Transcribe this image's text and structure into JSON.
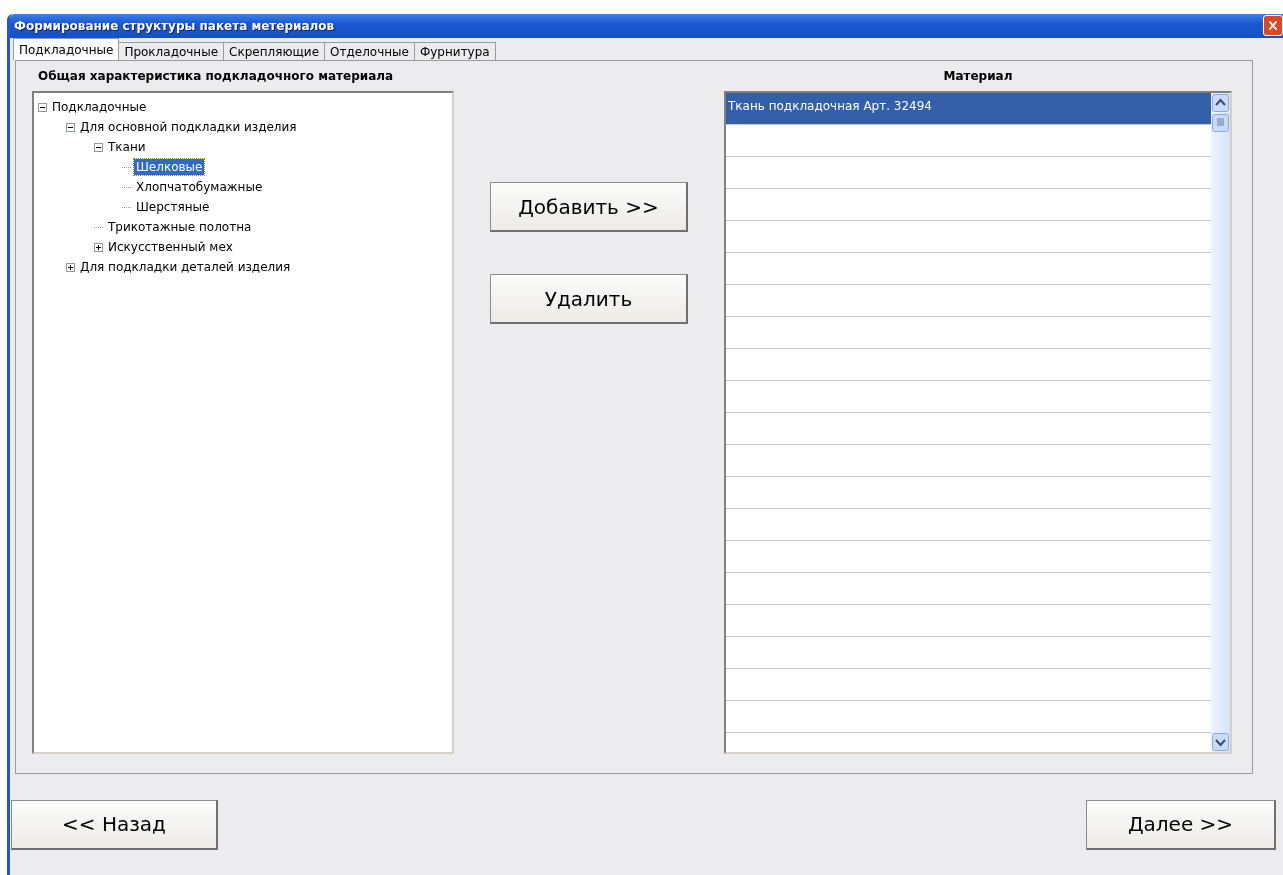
{
  "window": {
    "title": "Формирование структуры пакета метериалов"
  },
  "tabs": [
    {
      "label": "Подкладочные",
      "selected": true
    },
    {
      "label": "Прокладочные",
      "selected": false
    },
    {
      "label": "Скрепляющие",
      "selected": false
    },
    {
      "label": "Отделочные",
      "selected": false
    },
    {
      "label": "Фурнитура",
      "selected": false
    }
  ],
  "tree": {
    "title": "Общая характеристика подкладочного материала",
    "items": [
      {
        "label": "Подкладочные",
        "expanded": true,
        "selected": false,
        "children": [
          {
            "label": "Для основной подкладки изделия",
            "expanded": true,
            "selected": false,
            "children": [
              {
                "label": "Ткани",
                "expanded": true,
                "selected": false,
                "children": [
                  {
                    "label": "Шелковые",
                    "selected": true
                  },
                  {
                    "label": "Хлопчатобумажные",
                    "selected": false
                  },
                  {
                    "label": "Шерстяные",
                    "selected": false
                  }
                ]
              },
              {
                "label": "Трикотажные полотна",
                "selected": false
              },
              {
                "label": "Искусственный мех",
                "expanded": false,
                "selected": false
              }
            ]
          },
          {
            "label": "Для подкладки деталей изделия",
            "expanded": false,
            "selected": false
          }
        ]
      }
    ]
  },
  "actions": [
    "Добавить >>",
    "Удалить"
  ],
  "material_list": {
    "title": "Материал",
    "rows": [
      {
        "label": "Ткань подкладочная Арт. 32494",
        "selected": true
      }
    ]
  },
  "footer": {
    "back": "<< Назад",
    "next": "Далее >>"
  }
}
